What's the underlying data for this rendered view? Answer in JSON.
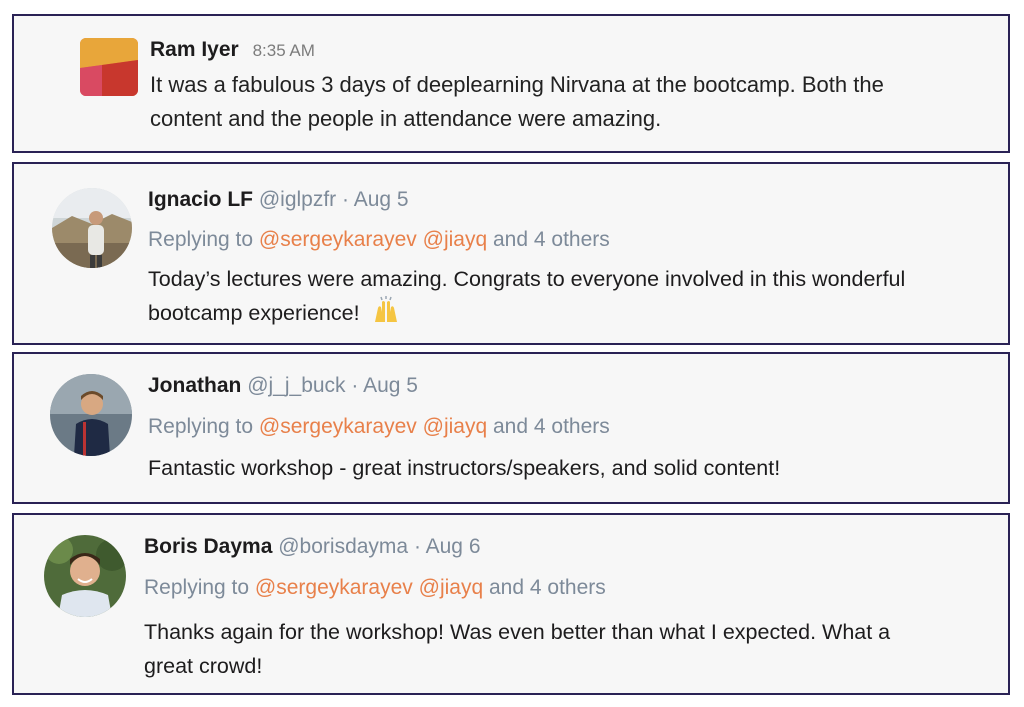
{
  "slack_message": {
    "author": "Ram Iyer",
    "time": "8:35 AM",
    "text_line1": "It was a fabulous 3 days of deeplearning Nirvana at the bootcamp. Both the",
    "text_line2": "content and the people in attendance were amazing.",
    "logo_colors": [
      "#e8a63a",
      "#c8372d",
      "#d94a62",
      "#e56a3b"
    ]
  },
  "tweets": [
    {
      "name": "Ignacio LF",
      "handle": "@iglpzfr",
      "date": "· Aug 5",
      "replying_prefix": "Replying to",
      "mention1": "@sergeykarayev",
      "mention2": "@jiayq",
      "replying_suffix": "and 4 others",
      "text_line1": "Today’s lectures were amazing. Congrats to everyone involved in this wonderful",
      "text_line2": "bootcamp experience!",
      "emoji": "raising-hands-icon"
    },
    {
      "name": "Jonathan",
      "handle": "@j_j_buck",
      "date": "· Aug 5",
      "replying_prefix": "Replying to",
      "mention1": "@sergeykarayev",
      "mention2": "@jiayq",
      "replying_suffix": "and 4 others",
      "text_line1": "Fantastic workshop - great instructors/speakers, and solid content!"
    },
    {
      "name": "Boris Dayma",
      "handle": "@borisdayma",
      "date": "· Aug 6",
      "replying_prefix": "Replying to",
      "mention1": "@sergeykarayev",
      "mention2": "@jiayq",
      "replying_suffix": "and 4 others",
      "text_line1": "Thanks again for the workshop! Was even better than what I expected. What a",
      "text_line2": "great crowd!"
    }
  ],
  "colors": {
    "border": "#2a2255",
    "mention": "#e8804a",
    "meta": "#7d8a99"
  }
}
